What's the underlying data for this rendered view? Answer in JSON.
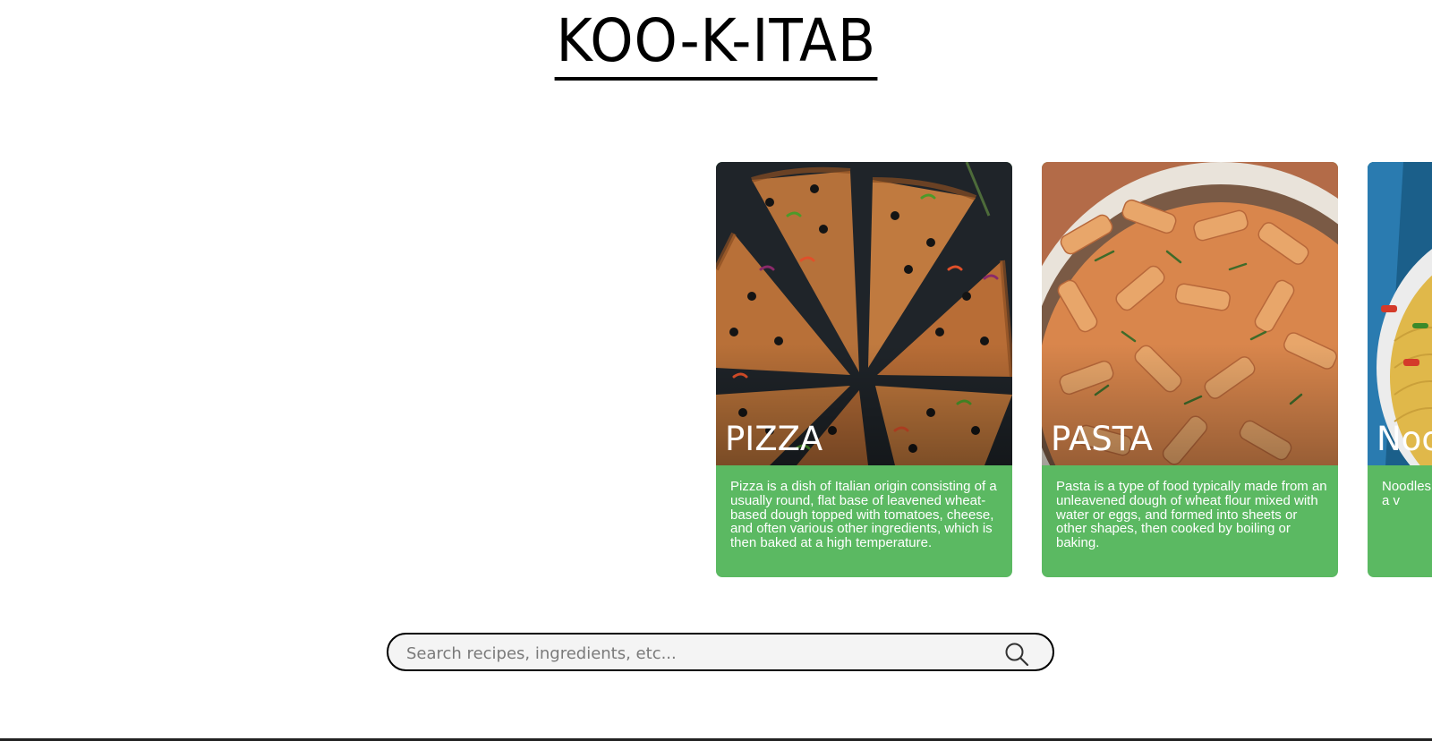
{
  "header": {
    "title": "KOO-K-ITAB"
  },
  "cards": [
    {
      "title": "PIZZA",
      "description": "Pizza is a dish of Italian origin consisting of a usually round, flat base of leavened wheat-based dough topped with tomatoes, cheese, and often various other ingredients, which is then baked at a high temperature."
    },
    {
      "title": "PASTA",
      "description": "Pasta is a type of food typically made from an unleavened dough of wheat flour mixed with water or eggs, and formed into sheets or other shapes, then cooked by boiling or baking."
    },
    {
      "title": "Noo",
      "description": "Noodles unleave flat and long str staple f into a v"
    }
  ],
  "search": {
    "placeholder": "Search recipes, ingredients, etc...",
    "value": "",
    "icon": "search-icon"
  },
  "colors": {
    "card_accent": "#5bb962",
    "title_text": "#000000",
    "search_background": "#f4f4f4"
  }
}
